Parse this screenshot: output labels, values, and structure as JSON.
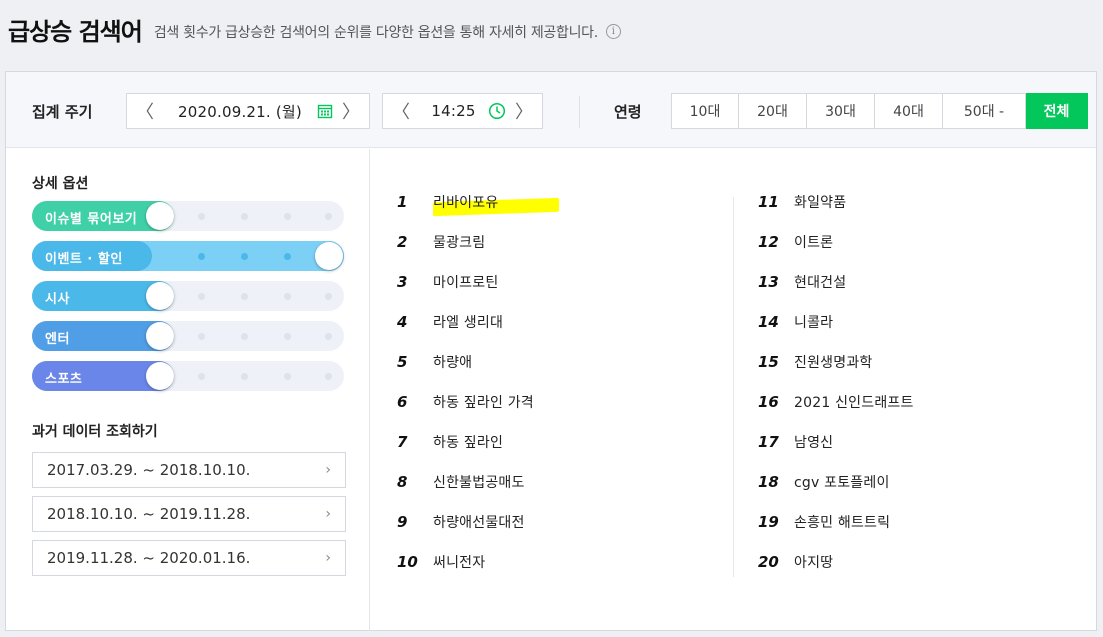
{
  "header": {
    "title": "급상승 검색어",
    "description": "검색 횟수가 급상승한 검색어의 순위를 다양한 옵션을 통해 자세히 제공합니다.",
    "info_glyph": "i"
  },
  "toolbar": {
    "period_label": "집계 주기",
    "date": "2020.09.21. (월)",
    "time": "14:25",
    "age_label": "연령",
    "age_options": [
      "10대",
      "20대",
      "30대",
      "40대",
      "50대 -",
      "전체"
    ],
    "age_selected": "전체",
    "prev_glyph": "〈",
    "next_glyph": "〉"
  },
  "options": {
    "title": "상세 옵션",
    "toggles": [
      {
        "label": "이슈별 묶어보기",
        "on": false,
        "color": "#3fd0a8"
      },
      {
        "label": "이벤트 · 할인",
        "on": true,
        "color": "#4ab8e8"
      },
      {
        "label": "시사",
        "on": false,
        "color": "#4ab8e8"
      },
      {
        "label": "엔터",
        "on": false,
        "color": "#4f9ee6"
      },
      {
        "label": "스포츠",
        "on": false,
        "color": "#6a86e8"
      }
    ]
  },
  "history": {
    "title": "과거 데이터 조회하기",
    "ranges": [
      "2017.03.29. ~ 2018.10.10.",
      "2018.10.10. ~ 2019.11.28.",
      "2019.11.28. ~ 2020.01.16."
    ],
    "chevron": "›"
  },
  "ranking": {
    "left": [
      {
        "rank": "1",
        "keyword": "리바이포유"
      },
      {
        "rank": "2",
        "keyword": "물광크림"
      },
      {
        "rank": "3",
        "keyword": "마이프로틴"
      },
      {
        "rank": "4",
        "keyword": "라엘 생리대"
      },
      {
        "rank": "5",
        "keyword": "하량애"
      },
      {
        "rank": "6",
        "keyword": "하동 짚라인 가격"
      },
      {
        "rank": "7",
        "keyword": "하동 짚라인"
      },
      {
        "rank": "8",
        "keyword": "신한불법공매도"
      },
      {
        "rank": "9",
        "keyword": "하량애선물대전"
      },
      {
        "rank": "10",
        "keyword": "써니전자"
      }
    ],
    "right": [
      {
        "rank": "11",
        "keyword": "화일약품"
      },
      {
        "rank": "12",
        "keyword": "이트론"
      },
      {
        "rank": "13",
        "keyword": "현대건설"
      },
      {
        "rank": "14",
        "keyword": "니콜라"
      },
      {
        "rank": "15",
        "keyword": "진원생명과학"
      },
      {
        "rank": "16",
        "keyword": "2021 신인드래프트"
      },
      {
        "rank": "17",
        "keyword": "남영신"
      },
      {
        "rank": "18",
        "keyword": "cgv 포토플레이"
      },
      {
        "rank": "19",
        "keyword": "손흥민 해트트릭"
      },
      {
        "rank": "20",
        "keyword": "아지땅"
      }
    ]
  },
  "colors": {
    "accent": "#03c75a",
    "highlight": "#ffff00"
  }
}
